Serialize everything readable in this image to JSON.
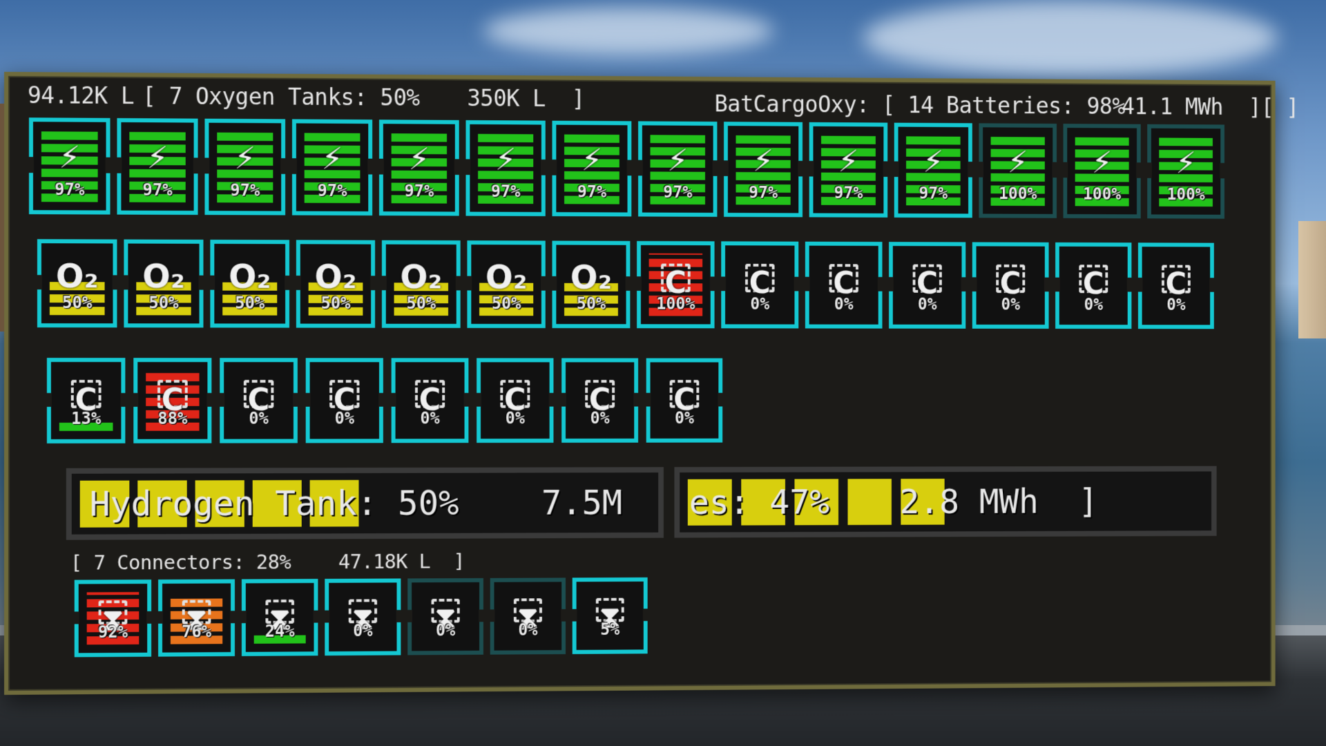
{
  "header": {
    "oxygen_volume": "94.12K L",
    "oxygen_group": "[ 7 Oxygen Tanks: 50%",
    "oxygen_capacity": "350K L  ]",
    "battery_group": "BatCargoOxy: [ 14 Batteries: 98%",
    "battery_energy": "41.1 MWh  ][ ]"
  },
  "batteries": [
    {
      "pct": "97%",
      "fill": 0.97
    },
    {
      "pct": "97%",
      "fill": 0.97
    },
    {
      "pct": "97%",
      "fill": 0.97
    },
    {
      "pct": "97%",
      "fill": 0.97
    },
    {
      "pct": "97%",
      "fill": 0.97
    },
    {
      "pct": "97%",
      "fill": 0.97
    },
    {
      "pct": "97%",
      "fill": 0.97
    },
    {
      "pct": "97%",
      "fill": 0.97
    },
    {
      "pct": "97%",
      "fill": 0.97
    },
    {
      "pct": "97%",
      "fill": 0.97
    },
    {
      "pct": "97%",
      "fill": 0.97
    },
    {
      "pct": "100%",
      "fill": 1.0,
      "dim": true
    },
    {
      "pct": "100%",
      "fill": 1.0,
      "dim": true
    },
    {
      "pct": "100%",
      "fill": 1.0,
      "dim": true
    }
  ],
  "row2": [
    {
      "kind": "oxygen",
      "glyph": "O₂",
      "pct": "50%",
      "fill": 0.5,
      "color": "#d8cf0e"
    },
    {
      "kind": "oxygen",
      "glyph": "O₂",
      "pct": "50%",
      "fill": 0.5,
      "color": "#d8cf0e"
    },
    {
      "kind": "oxygen",
      "glyph": "O₂",
      "pct": "50%",
      "fill": 0.5,
      "color": "#d8cf0e"
    },
    {
      "kind": "oxygen",
      "glyph": "O₂",
      "pct": "50%",
      "fill": 0.5,
      "color": "#d8cf0e"
    },
    {
      "kind": "oxygen",
      "glyph": "O₂",
      "pct": "50%",
      "fill": 0.5,
      "color": "#d8cf0e"
    },
    {
      "kind": "oxygen",
      "glyph": "O₂",
      "pct": "50%",
      "fill": 0.5,
      "color": "#d8cf0e"
    },
    {
      "kind": "oxygen",
      "glyph": "O₂",
      "pct": "50%",
      "fill": 0.5,
      "color": "#d8cf0e"
    },
    {
      "kind": "cargo",
      "glyph": "C",
      "pct": "100%",
      "fill": 1.0,
      "color": "#e02518"
    },
    {
      "kind": "cargo",
      "glyph": "C",
      "pct": "0%",
      "fill": 0,
      "color": "#22c21a"
    },
    {
      "kind": "cargo",
      "glyph": "C",
      "pct": "0%",
      "fill": 0,
      "color": "#22c21a"
    },
    {
      "kind": "cargo",
      "glyph": "C",
      "pct": "0%",
      "fill": 0,
      "color": "#22c21a"
    },
    {
      "kind": "cargo",
      "glyph": "C",
      "pct": "0%",
      "fill": 0,
      "color": "#22c21a"
    },
    {
      "kind": "cargo",
      "glyph": "C",
      "pct": "0%",
      "fill": 0,
      "color": "#22c21a"
    },
    {
      "kind": "cargo",
      "glyph": "C",
      "pct": "0%",
      "fill": 0,
      "color": "#22c21a"
    }
  ],
  "row3": [
    {
      "kind": "cargo",
      "glyph": "C",
      "pct": "13%",
      "fill": 0.13,
      "color": "#22c21a"
    },
    {
      "kind": "cargo",
      "glyph": "C",
      "pct": "88%",
      "fill": 0.88,
      "color": "#e02518"
    },
    {
      "kind": "cargo",
      "glyph": "C",
      "pct": "0%",
      "fill": 0,
      "color": "#22c21a"
    },
    {
      "kind": "cargo",
      "glyph": "C",
      "pct": "0%",
      "fill": 0,
      "color": "#22c21a"
    },
    {
      "kind": "cargo",
      "glyph": "C",
      "pct": "0%",
      "fill": 0,
      "color": "#22c21a"
    },
    {
      "kind": "cargo",
      "glyph": "C",
      "pct": "0%",
      "fill": 0,
      "color": "#22c21a"
    },
    {
      "kind": "cargo",
      "glyph": "C",
      "pct": "0%",
      "fill": 0,
      "color": "#22c21a"
    },
    {
      "kind": "cargo",
      "glyph": "C",
      "pct": "0%",
      "fill": 0,
      "color": "#22c21a"
    }
  ],
  "hydrogen": {
    "label": "Hydrogen Tank: 50%",
    "capacity": "7.5M",
    "fill": 0.5
  },
  "batteries_bar": {
    "label": "es: 47%",
    "energy": "2.8 MWh  ]",
    "fill": 0.47
  },
  "connectors_header": {
    "group": "[ 7 Connectors: 28%",
    "volume": "47.18K L  ]"
  },
  "connectors": [
    {
      "pct": "92%",
      "fill": 0.92,
      "color": "#e02518"
    },
    {
      "pct": "76%",
      "fill": 0.76,
      "color": "#e7731c"
    },
    {
      "pct": "24%",
      "fill": 0.24,
      "color": "#22c21a"
    },
    {
      "pct": "0%",
      "fill": 0,
      "color": "#22c21a"
    },
    {
      "pct": "0%",
      "fill": 0,
      "color": "#22c21a",
      "dim": true
    },
    {
      "pct": "0%",
      "fill": 0,
      "color": "#22c21a",
      "dim": true
    },
    {
      "pct": "5%",
      "fill": 0.05,
      "color": "#22c21a"
    }
  ],
  "colors": {
    "frame": "#14c8d2",
    "battery": "#22c21a",
    "oxygen": "#d8cf0e",
    "cargo_full": "#e02518"
  }
}
